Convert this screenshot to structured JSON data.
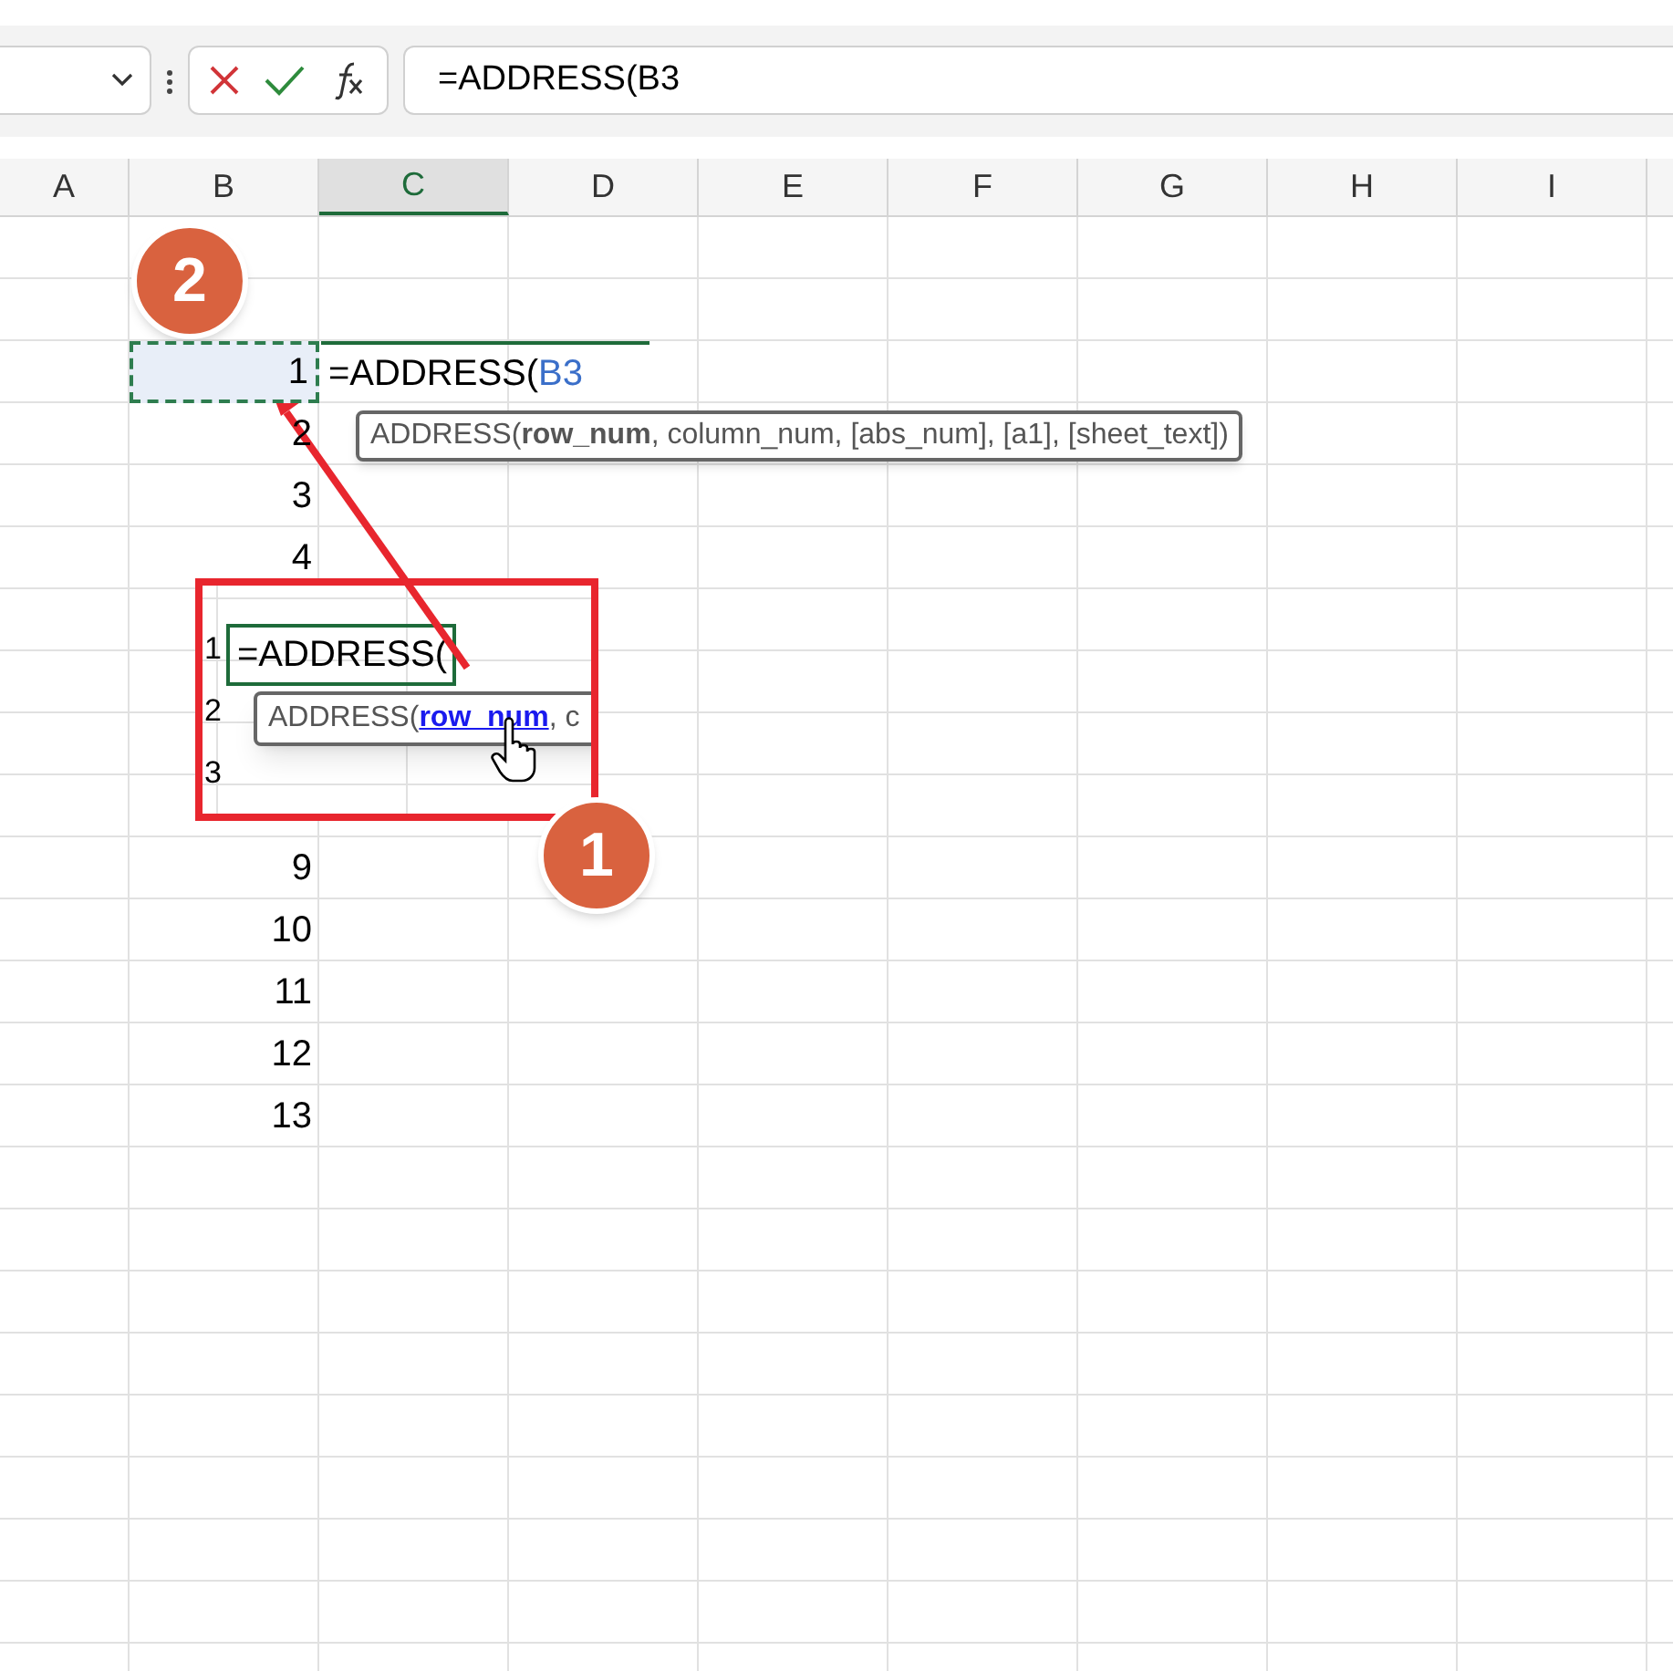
{
  "formula_bar": {
    "formula": "=ADDRESS(B3"
  },
  "columns": [
    {
      "label": "A",
      "selected": false
    },
    {
      "label": "B",
      "selected": false
    },
    {
      "label": "C",
      "selected": true
    },
    {
      "label": "D",
      "selected": false
    },
    {
      "label": "E",
      "selected": false
    },
    {
      "label": "F",
      "selected": false
    },
    {
      "label": "G",
      "selected": false
    },
    {
      "label": "H",
      "selected": false
    },
    {
      "label": "I",
      "selected": false
    }
  ],
  "column_b": {
    "top": [
      {
        "value": "1",
        "selected": true
      },
      {
        "value": "2",
        "selected": false
      },
      {
        "value": "3",
        "selected": false
      },
      {
        "value": "4",
        "selected": false
      }
    ],
    "bottom": [
      {
        "value": "9",
        "selected": false
      },
      {
        "value": "10",
        "selected": false
      },
      {
        "value": "11",
        "selected": false
      },
      {
        "value": "12",
        "selected": false
      },
      {
        "value": "13",
        "selected": false
      }
    ]
  },
  "editing_cell": [
    {
      "text": "=ADDRESS(",
      "kind": "plain"
    },
    {
      "text": "B3",
      "kind": "reference"
    }
  ],
  "tooltip": "ADDRESS(**row_num**, column_num, [abs_num], [a1], [sheet_text])",
  "inset": {
    "edge_values": [
      "1",
      "2",
      "3"
    ],
    "cell": "=ADDRESS(",
    "tooltip": [
      {
        "text": "ADDRESS(",
        "kind": "plain"
      },
      {
        "text": "row_num",
        "kind": "link"
      },
      {
        "text": ", c",
        "kind": "plain"
      }
    ]
  },
  "badges": [
    "2",
    "1"
  ]
}
